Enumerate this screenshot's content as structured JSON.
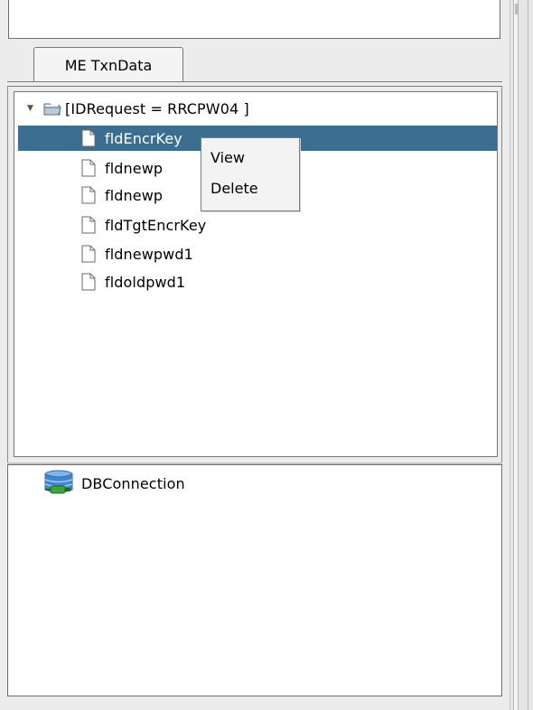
{
  "tab": {
    "label": "ME TxnData"
  },
  "tree": {
    "root_label": "[IDRequest = RRCPW04 ]",
    "children": [
      {
        "label": "fldEncrKey"
      },
      {
        "label": "fldnewp"
      },
      {
        "label": "fldnewp"
      },
      {
        "label": "fldTgtEncrKey"
      },
      {
        "label": "fldnewpwd1"
      },
      {
        "label": "fldoldpwd1"
      }
    ]
  },
  "context_menu": {
    "items": [
      {
        "label": "View"
      },
      {
        "label": "Delete"
      }
    ]
  },
  "bottom_panel": {
    "items": [
      {
        "label": "DBConnection"
      }
    ]
  },
  "colors": {
    "selection": "#3b6f92",
    "folder": "#8aa9c4",
    "db_blue": "#3f86cf",
    "db_green": "#3aa33a"
  },
  "icons": {
    "root": "folder-icon",
    "child": "document-icon",
    "bottom": "database-connection-icon"
  }
}
